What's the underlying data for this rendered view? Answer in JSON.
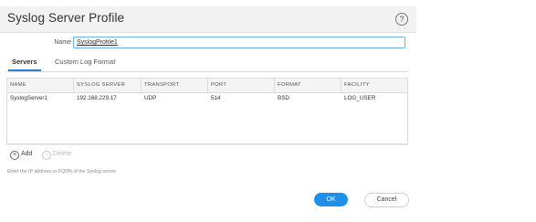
{
  "dialog": {
    "title": "Syslog Server Profile",
    "help_icon": "help-icon",
    "help_glyph": "?"
  },
  "name_field": {
    "label": "Name",
    "value": "SyslogProfile1"
  },
  "tabs": [
    {
      "label": "Servers",
      "active": true
    },
    {
      "label": "Custom Log Format",
      "active": false
    }
  ],
  "table": {
    "columns": [
      "NAME",
      "SYSLOG SERVER",
      "TRANSPORT",
      "PORT",
      "FORMAT",
      "FACILITY"
    ],
    "rows": [
      [
        "SyslogServer1",
        "192.168.229.17",
        "UDP",
        "514",
        "BSD",
        "LOG_USER"
      ]
    ]
  },
  "table_actions": {
    "add_label": "Add",
    "delete_label": "Delete",
    "add_icon": "plus-circle-icon",
    "delete_icon": "minus-circle-icon"
  },
  "hint": "Enter the IP address or FQDN of the Syslog server",
  "buttons": {
    "ok_label": "OK",
    "cancel_label": "Cancel"
  },
  "colors": {
    "accent": "#1e90e8",
    "tab_underline": "#2a7fd4",
    "input_border": "#6db3e6"
  }
}
